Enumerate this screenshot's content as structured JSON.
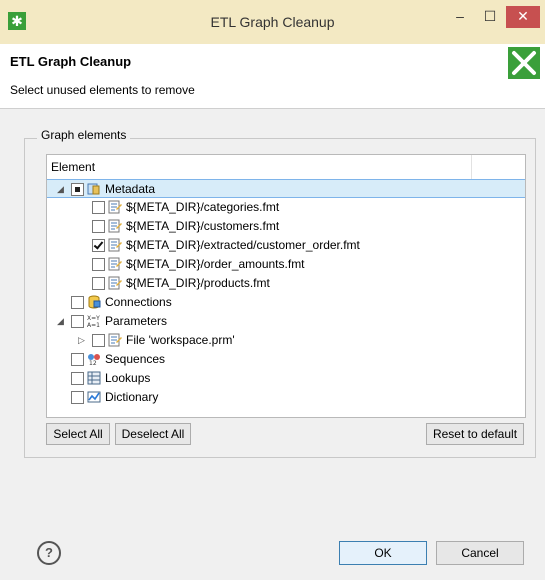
{
  "window": {
    "title": "ETL Graph Cleanup",
    "minimize": "–",
    "maximize": "☐",
    "close": "✕"
  },
  "header": {
    "title": "ETL Graph Cleanup",
    "subtitle": "Select unused elements to remove"
  },
  "group": {
    "label": "Graph elements"
  },
  "tree": {
    "column_header": "Element",
    "metadata": {
      "label": "Metadata",
      "state": "partial",
      "expanded": true,
      "children": [
        {
          "label": "${META_DIR}/categories.fmt",
          "checked": false
        },
        {
          "label": "${META_DIR}/customers.fmt",
          "checked": false
        },
        {
          "label": "${META_DIR}/extracted/customer_order.fmt",
          "checked": true
        },
        {
          "label": "${META_DIR}/order_amounts.fmt",
          "checked": false
        },
        {
          "label": "${META_DIR}/products.fmt",
          "checked": false
        }
      ]
    },
    "connections": {
      "label": "Connections",
      "checked": false
    },
    "parameters": {
      "label": "Parameters",
      "checked": false,
      "expanded": true,
      "children": [
        {
          "label": "File 'workspace.prm'",
          "checked": false,
          "expanded": false
        }
      ]
    },
    "sequences": {
      "label": "Sequences",
      "checked": false
    },
    "lookups": {
      "label": "Lookups",
      "checked": false
    },
    "dictionary": {
      "label": "Dictionary",
      "checked": false
    }
  },
  "buttons": {
    "select_all": "Select All",
    "deselect_all": "Deselect All",
    "reset": "Reset to default",
    "ok": "OK",
    "cancel": "Cancel",
    "help": "?"
  },
  "colors": {
    "selection": "#d7ecf9",
    "titlebar": "#f3e9c3",
    "close": "#c75050",
    "logo_green": "#3a9f3a"
  }
}
